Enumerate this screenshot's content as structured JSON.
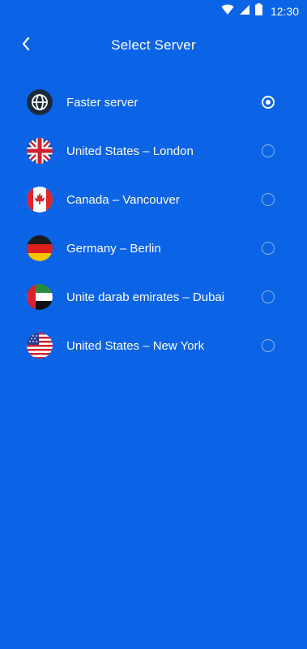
{
  "status_bar": {
    "time": "12:30",
    "icons": [
      "wifi-icon",
      "cellular-signal-icon",
      "battery-icon"
    ]
  },
  "header": {
    "title": "Select Server",
    "back_icon": "chevron-left-icon"
  },
  "colors": {
    "background": "#0b63e6",
    "text": "#ffffff"
  },
  "servers": [
    {
      "label": "Faster server",
      "icon": "globe-icon",
      "selected": true
    },
    {
      "label": "United States – London",
      "icon": "uk-flag-icon",
      "selected": false
    },
    {
      "label": "Canada – Vancouver",
      "icon": "canada-flag-icon",
      "selected": false
    },
    {
      "label": "Germany – Berlin",
      "icon": "germany-flag-icon",
      "selected": false
    },
    {
      "label": "Unite darab emirates – Dubai",
      "icon": "uae-flag-icon",
      "selected": false
    },
    {
      "label": "United States – New York",
      "icon": "usa-flag-icon",
      "selected": false
    }
  ]
}
